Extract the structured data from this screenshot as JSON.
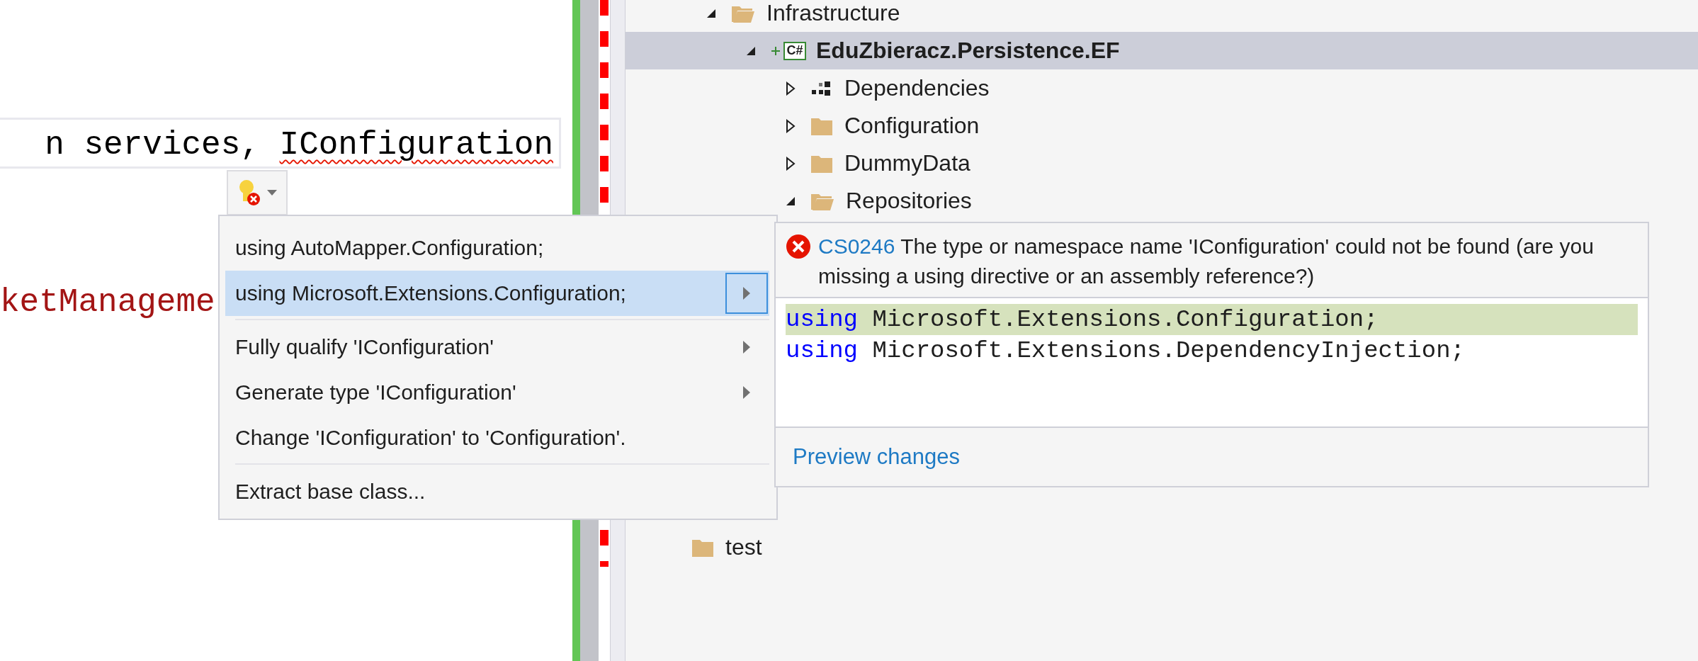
{
  "editor": {
    "lines": [
      {
        "current": true,
        "segments": [
          {
            "text": "n services, ",
            "kind": "plain"
          },
          {
            "text": "IConfiguration",
            "kind": "error"
          }
        ]
      },
      {
        "current": false,
        "segments": [
          {
            "text": "ketManageme",
            "kind": "string"
          }
        ]
      }
    ]
  },
  "quick_actions": {
    "groups": [
      [
        {
          "label": "using AutoMapper.Configuration;",
          "selected": false,
          "submenu": false
        },
        {
          "label": "using Microsoft.Extensions.Configuration;",
          "selected": true,
          "submenu": true
        }
      ],
      [
        {
          "label": "Fully qualify 'IConfiguration'",
          "selected": false,
          "submenu": true
        },
        {
          "label": "Generate type 'IConfiguration'",
          "selected": false,
          "submenu": true
        },
        {
          "label": "Change 'IConfiguration' to 'Configuration'.",
          "selected": false,
          "submenu": false
        }
      ],
      [
        {
          "label": "Extract base class...",
          "selected": false,
          "submenu": false
        }
      ]
    ]
  },
  "preview": {
    "code": "CS0246",
    "message": "The type or namespace name 'IConfiguration' could not be found (are you missing a using directive or an assembly reference?)",
    "lines": [
      {
        "keyword": "using",
        "text": " Microsoft.Extensions.Configuration;",
        "highlighted": true
      },
      {
        "keyword": "using",
        "text": " Microsoft.Extensions.DependencyInjection;",
        "highlighted": false
      }
    ],
    "link": "Preview changes"
  },
  "solution_explorer": {
    "items": [
      {
        "label": "Infrastructure",
        "kind": "folder",
        "expanded": true,
        "selected": false,
        "children": [
          {
            "label": "EduZbieracz.Persistence.EF",
            "kind": "project",
            "badge": "C#",
            "pending_add": true,
            "startup": true,
            "expanded": true,
            "selected": true,
            "children": [
              {
                "label": "Dependencies",
                "kind": "dependencies",
                "expanded": false,
                "selected": false
              },
              {
                "label": "Configuration",
                "kind": "folder",
                "expanded": false,
                "selected": false
              },
              {
                "label": "DummyData",
                "kind": "folder",
                "expanded": false,
                "selected": false
              },
              {
                "label": "Repositories",
                "kind": "folder",
                "expanded": true,
                "selected": false
              }
            ]
          }
        ]
      },
      {
        "label": "test",
        "kind": "folder",
        "selected": false
      }
    ]
  }
}
